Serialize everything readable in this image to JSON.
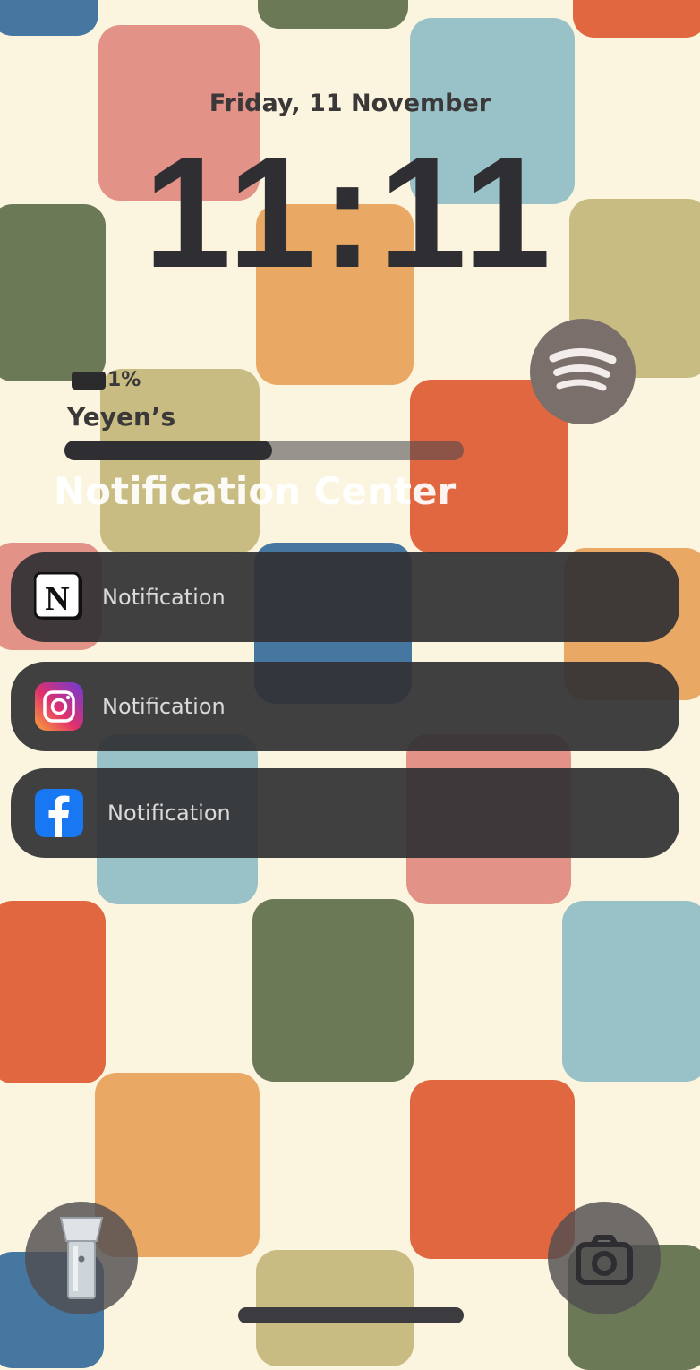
{
  "lockscreen": {
    "date": "Friday, 11 November",
    "time": "11:11"
  },
  "media_widget": {
    "battery_label": "1%",
    "device_name": "Yeyen’s",
    "progress": 0.52,
    "app_icon": "spotify-icon",
    "app_color": "#7b6f6c"
  },
  "notification_center": {
    "title": "Notification Center",
    "items": [
      {
        "app": "Notion",
        "icon": "notion-icon",
        "label": "Notification"
      },
      {
        "app": "Instagram",
        "icon": "instagram-icon",
        "label": "Notification"
      },
      {
        "app": "Facebook",
        "icon": "facebook-icon",
        "label": "Notification"
      }
    ]
  },
  "shortcuts": {
    "left_icon": "flashlight-icon",
    "right_icon": "camera-icon"
  },
  "colors": {
    "background": "#fbf4df",
    "text_dark": "#2f2f33",
    "notification_bg": "#323135",
    "palette": [
      "#5e6e4b",
      "#e0897f",
      "#8fbcc6",
      "#e8a15a",
      "#de5a32",
      "#c3b67a",
      "#356b9a"
    ]
  }
}
